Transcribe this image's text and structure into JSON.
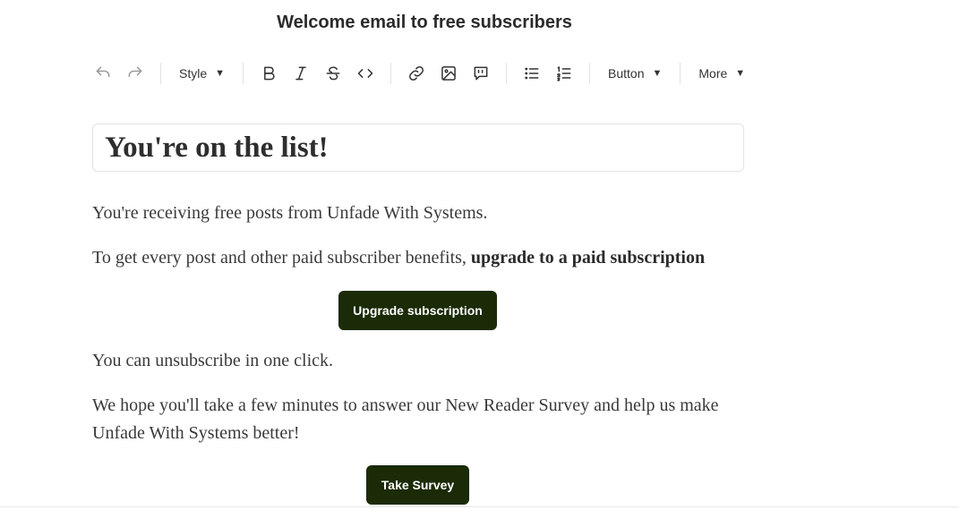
{
  "page": {
    "title": "Welcome email to free subscribers"
  },
  "toolbar": {
    "style_label": "Style",
    "button_label": "Button",
    "more_label": "More",
    "icons": [
      "undo-icon",
      "redo-icon",
      "bold-icon",
      "italic-icon",
      "strikethrough-icon",
      "code-icon",
      "link-icon",
      "image-icon",
      "quote-icon",
      "bullet-list-icon",
      "numbered-list-icon",
      "caret-down-icon"
    ]
  },
  "content": {
    "heading": "You're on the list!",
    "p1": "You're receiving free posts from Unfade With Systems.",
    "p2_prefix": "To get every post and other paid subscriber benefits, ",
    "p2_link": "upgrade to a paid subscription",
    "upgrade_button": "Upgrade subscription",
    "p3_prefix": "You can ",
    "p3_link": "unsubscribe in one click",
    "p3_suffix": ".",
    "p4": "We hope you'll take a few minutes to answer our New Reader Survey and help us make Unfade With Systems better!",
    "survey_button": "Take Survey"
  },
  "colors": {
    "button_bg": "#1b2b07",
    "button_text": "#ffffff",
    "text": "#3a3a3a"
  }
}
